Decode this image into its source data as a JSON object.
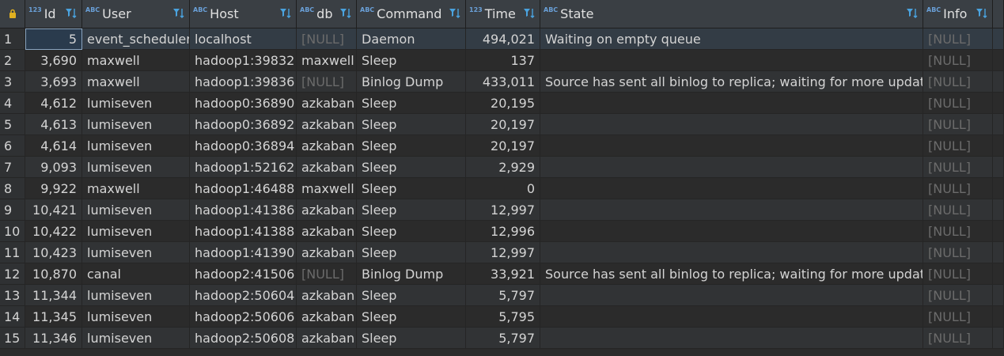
{
  "columns": [
    {
      "name": "Id",
      "type_icon": "123"
    },
    {
      "name": "User",
      "type_icon": "ABC"
    },
    {
      "name": "Host",
      "type_icon": "ABC"
    },
    {
      "name": "db",
      "type_icon": "ABC"
    },
    {
      "name": "Command",
      "type_icon": "ABC"
    },
    {
      "name": "Time",
      "type_icon": "123"
    },
    {
      "name": "State",
      "type_icon": "ABC"
    },
    {
      "name": "Info",
      "type_icon": "ABC"
    }
  ],
  "rows": [
    {
      "n": "1",
      "id": "5",
      "user": "event_scheduler",
      "host": "localhost",
      "db": "[NULL]",
      "command": "Daemon",
      "time": "494,021",
      "state": "Waiting on empty queue",
      "info": "[NULL]"
    },
    {
      "n": "2",
      "id": "3,690",
      "user": "maxwell",
      "host": "hadoop1:39832",
      "db": "maxwell",
      "command": "Sleep",
      "time": "137",
      "state": "",
      "info": "[NULL]"
    },
    {
      "n": "3",
      "id": "3,693",
      "user": "maxwell",
      "host": "hadoop1:39836",
      "db": "[NULL]",
      "command": "Binlog Dump",
      "time": "433,011",
      "state": "Source has sent all binlog to replica; waiting for more updates",
      "info": "[NULL]"
    },
    {
      "n": "4",
      "id": "4,612",
      "user": "lumiseven",
      "host": "hadoop0:36890",
      "db": "azkaban",
      "command": "Sleep",
      "time": "20,195",
      "state": "",
      "info": "[NULL]"
    },
    {
      "n": "5",
      "id": "4,613",
      "user": "lumiseven",
      "host": "hadoop0:36892",
      "db": "azkaban",
      "command": "Sleep",
      "time": "20,197",
      "state": "",
      "info": "[NULL]"
    },
    {
      "n": "6",
      "id": "4,614",
      "user": "lumiseven",
      "host": "hadoop0:36894",
      "db": "azkaban",
      "command": "Sleep",
      "time": "20,197",
      "state": "",
      "info": "[NULL]"
    },
    {
      "n": "7",
      "id": "9,093",
      "user": "lumiseven",
      "host": "hadoop1:52162",
      "db": "azkaban",
      "command": "Sleep",
      "time": "2,929",
      "state": "",
      "info": "[NULL]"
    },
    {
      "n": "8",
      "id": "9,922",
      "user": "maxwell",
      "host": "hadoop1:46488",
      "db": "maxwell",
      "command": "Sleep",
      "time": "0",
      "state": "",
      "info": "[NULL]"
    },
    {
      "n": "9",
      "id": "10,421",
      "user": "lumiseven",
      "host": "hadoop1:41386",
      "db": "azkaban",
      "command": "Sleep",
      "time": "12,997",
      "state": "",
      "info": "[NULL]"
    },
    {
      "n": "10",
      "id": "10,422",
      "user": "lumiseven",
      "host": "hadoop1:41388",
      "db": "azkaban",
      "command": "Sleep",
      "time": "12,996",
      "state": "",
      "info": "[NULL]"
    },
    {
      "n": "11",
      "id": "10,423",
      "user": "lumiseven",
      "host": "hadoop1:41390",
      "db": "azkaban",
      "command": "Sleep",
      "time": "12,997",
      "state": "",
      "info": "[NULL]"
    },
    {
      "n": "12",
      "id": "10,870",
      "user": "canal",
      "host": "hadoop2:41506",
      "db": "[NULL]",
      "command": "Binlog Dump",
      "time": "33,921",
      "state": "Source has sent all binlog to replica; waiting for more updates",
      "info": "[NULL]"
    },
    {
      "n": "13",
      "id": "11,344",
      "user": "lumiseven",
      "host": "hadoop2:50604",
      "db": "azkaban",
      "command": "Sleep",
      "time": "5,797",
      "state": "",
      "info": "[NULL]"
    },
    {
      "n": "14",
      "id": "11,345",
      "user": "lumiseven",
      "host": "hadoop2:50606",
      "db": "azkaban",
      "command": "Sleep",
      "time": "5,795",
      "state": "",
      "info": "[NULL]"
    },
    {
      "n": "15",
      "id": "11,346",
      "user": "lumiseven",
      "host": "hadoop2:50608",
      "db": "azkaban",
      "command": "Sleep",
      "time": "5,797",
      "state": "",
      "info": "[NULL]"
    }
  ],
  "colors": {
    "background": "#2b2b2b",
    "header": "#3a3f44",
    "null_text": "#6b6b6b",
    "accent": "#4aa3df"
  },
  "icons": {
    "corner": "lock-icon",
    "column_sort": "filter-sort-icon"
  }
}
